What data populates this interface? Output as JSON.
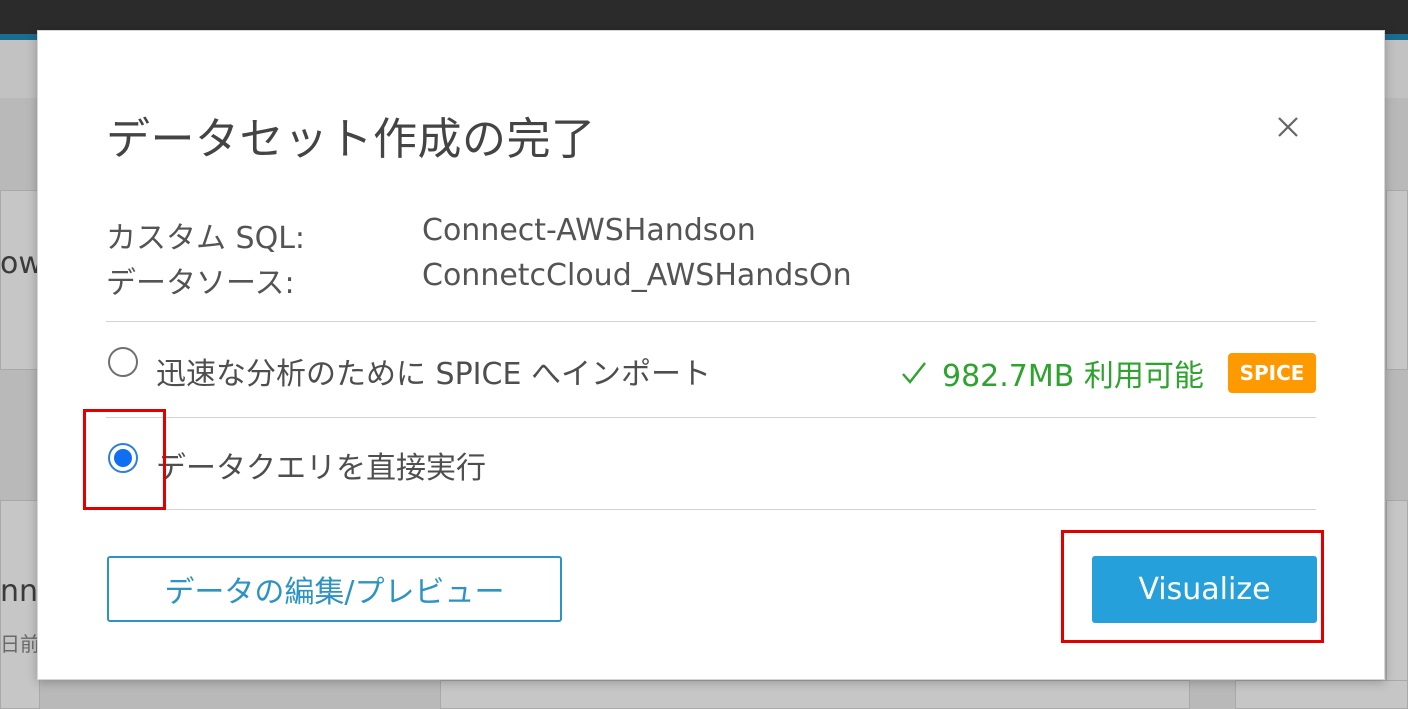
{
  "background": {
    "partial_text_1": "ow",
    "partial_text_2": "nnec",
    "partial_text_3": "日前"
  },
  "dialog": {
    "title": "データセット作成の完了",
    "close_icon": "close-icon",
    "info": {
      "custom_sql_label": "カスタム SQL:",
      "custom_sql_value": "Connect-AWSHandson",
      "data_source_label": "データソース:",
      "data_source_value": "ConnetcCloud_AWSHandsOn"
    },
    "options": {
      "spice": {
        "label": "迅速な分析のために SPICE へインポート",
        "selected": false,
        "availability": "982.7MB 利用可能",
        "badge": "SPICE"
      },
      "direct_query": {
        "label": "データクエリを直接実行",
        "selected": true
      }
    },
    "buttons": {
      "edit_preview": "データの編集/プレビュー",
      "visualize": "Visualize"
    }
  },
  "colors": {
    "accent_blue": "#26a0da",
    "available_green": "#2ea32e",
    "spice_orange": "#ff9900",
    "highlight_red": "#e00000",
    "radio_selected": "#0f6ef2"
  }
}
